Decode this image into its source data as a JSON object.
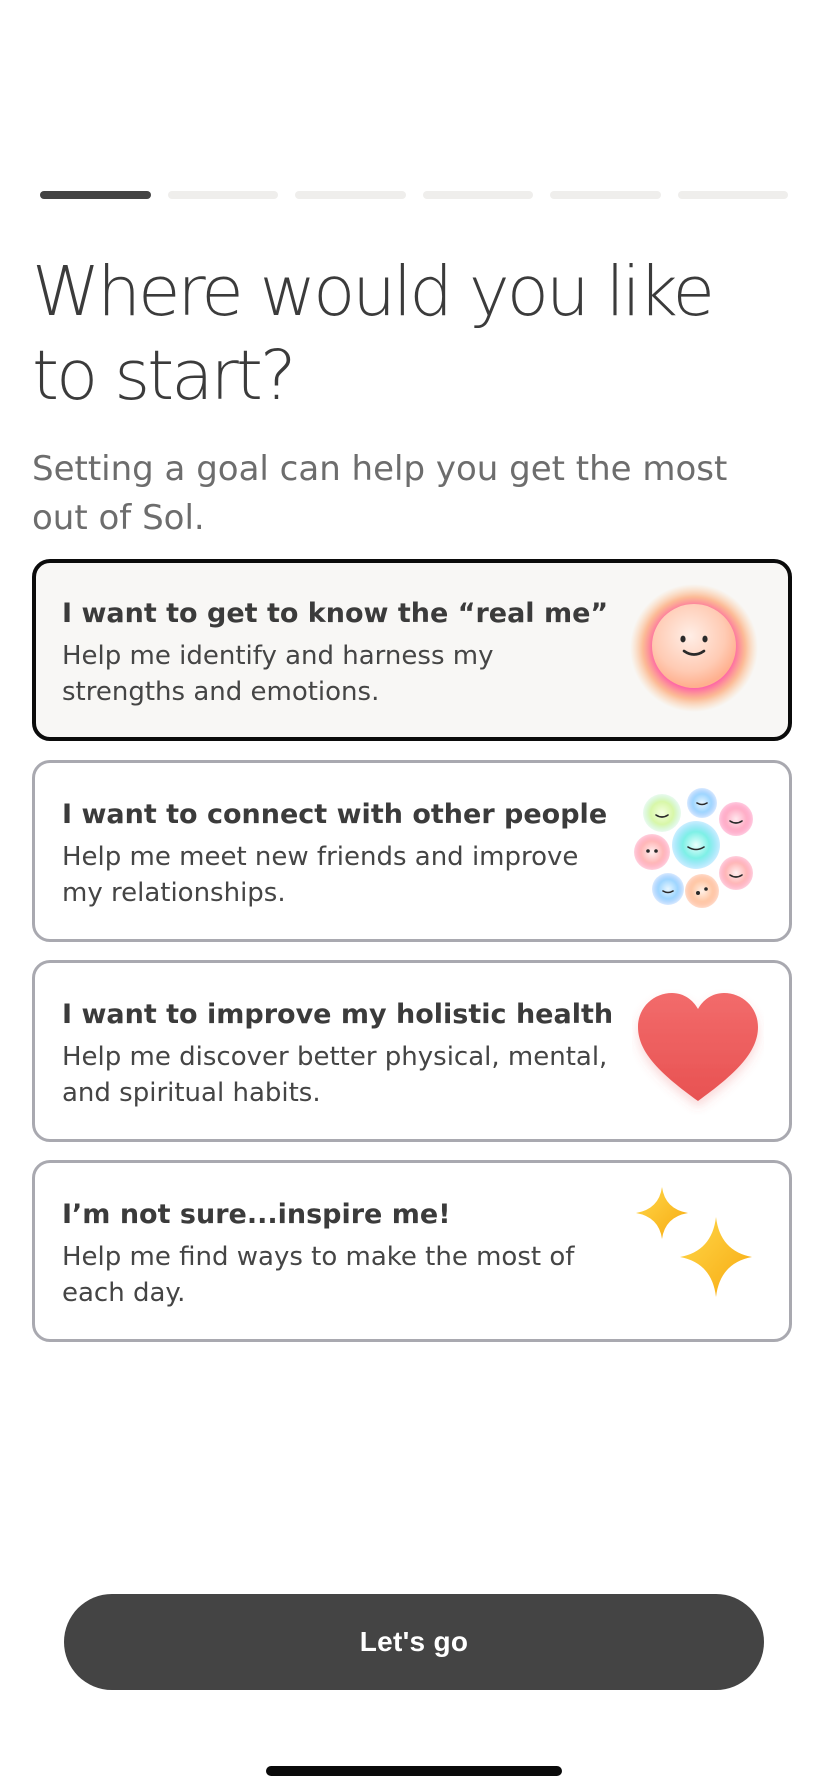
{
  "progress": {
    "total_steps": 6,
    "current_step": 1
  },
  "heading": {
    "title": "Where would you like to start?",
    "subtitle": "Setting a goal can help you get the most out of Sol."
  },
  "goals": [
    {
      "title": "I want to get to know the “real me”",
      "description": "Help me identify and harness my strengths and emotions.",
      "icon": "smiley-orb-icon",
      "selected": true
    },
    {
      "title": "I want to connect with other people",
      "description": "Help me meet new friends and improve my relationships.",
      "icon": "smiley-bubbles-icon",
      "selected": false
    },
    {
      "title": "I want to improve my holistic health",
      "description": "Help me discover better physical, mental, and spiritual habits.",
      "icon": "heart-icon",
      "selected": false
    },
    {
      "title": "I’m not sure...inspire me!",
      "description": "Help me find ways to make the most of each day.",
      "icon": "sparkles-icon",
      "selected": false
    }
  ],
  "cta": {
    "label": "Let's go"
  },
  "colors": {
    "primary_button": "#444444",
    "selected_border": "#0b0b0b",
    "card_border": "#a9a9b0",
    "progress_inactive": "#efeeec",
    "heart": "#ee5f5f",
    "sparkle": "#fdbd16"
  }
}
